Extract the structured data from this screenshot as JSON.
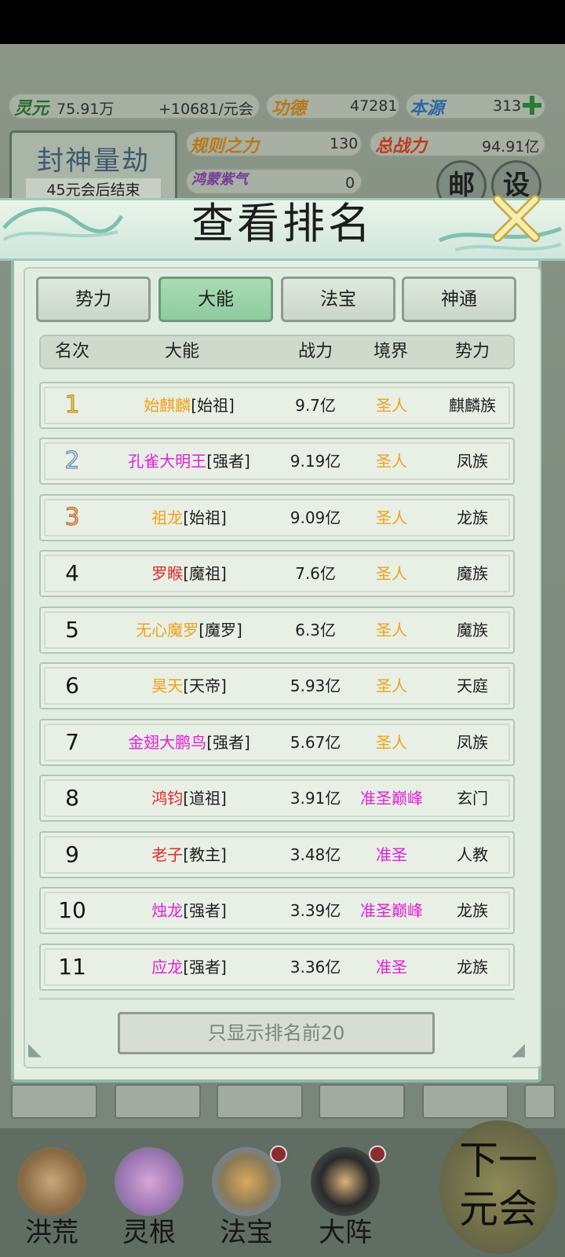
{
  "resources": {
    "lingyuan_label": "灵元",
    "lingyuan_value": "75.91万",
    "lingyuan_rate": "+10681/元会",
    "gongde_label": "功德",
    "gongde_value": "47281",
    "benyuan_label": "本源",
    "benyuan_value": "313",
    "guize_label": "规则之力",
    "guize_value": "130",
    "zongzhanli_label": "总战力",
    "zongzhanli_value": "94.91亿",
    "hongmeng_label": "鸿蒙紫气",
    "hongmeng_value": "0"
  },
  "event": {
    "title": "封神量劫",
    "subtitle": "45元会后结束"
  },
  "side_icons": {
    "mail": "邮",
    "settings": "设"
  },
  "modal": {
    "title": "查看排名",
    "tabs": [
      {
        "label": "势力",
        "active": false
      },
      {
        "label": "大能",
        "active": true
      },
      {
        "label": "法宝",
        "active": false
      },
      {
        "label": "神通",
        "active": false
      }
    ],
    "headers": [
      "名次",
      "大能",
      "战力",
      "境界",
      "势力"
    ],
    "rows": [
      {
        "rank": "1",
        "name": "始麒麟",
        "title": "[始祖]",
        "power": "9.7亿",
        "realm": "圣人",
        "faction": "麒麟族",
        "name_color": "#f0a21a",
        "realm_color": "#f0a21a"
      },
      {
        "rank": "2",
        "name": "孔雀大明王",
        "title": "[强者]",
        "power": "9.19亿",
        "realm": "圣人",
        "faction": "凤族",
        "name_color": "#e020d8",
        "realm_color": "#f0a21a"
      },
      {
        "rank": "3",
        "name": "祖龙",
        "title": "[始祖]",
        "power": "9.09亿",
        "realm": "圣人",
        "faction": "龙族",
        "name_color": "#f0a21a",
        "realm_color": "#f0a21a"
      },
      {
        "rank": "4",
        "name": "罗睺",
        "title": "[魔祖]",
        "power": "7.6亿",
        "realm": "圣人",
        "faction": "魔族",
        "name_color": "#e22828",
        "realm_color": "#f0a21a"
      },
      {
        "rank": "5",
        "name": "无心魔罗",
        "title": "[魔罗]",
        "power": "6.3亿",
        "realm": "圣人",
        "faction": "魔族",
        "name_color": "#f0a21a",
        "realm_color": "#f0a21a"
      },
      {
        "rank": "6",
        "name": "昊天",
        "title": "[天帝]",
        "power": "5.93亿",
        "realm": "圣人",
        "faction": "天庭",
        "name_color": "#f0a21a",
        "realm_color": "#f0a21a"
      },
      {
        "rank": "7",
        "name": "金翅大鹏鸟",
        "title": "[强者]",
        "power": "5.67亿",
        "realm": "圣人",
        "faction": "凤族",
        "name_color": "#e020d8",
        "realm_color": "#f0a21a"
      },
      {
        "rank": "8",
        "name": "鸿钧",
        "title": "[道祖]",
        "power": "3.91亿",
        "realm": "准圣巅峰",
        "faction": "玄门",
        "name_color": "#e22828",
        "realm_color": "#e020d8"
      },
      {
        "rank": "9",
        "name": "老子",
        "title": "[教主]",
        "power": "3.48亿",
        "realm": "准圣",
        "faction": "人教",
        "name_color": "#e22828",
        "realm_color": "#e020d8"
      },
      {
        "rank": "10",
        "name": "烛龙",
        "title": "[强者]",
        "power": "3.39亿",
        "realm": "准圣巅峰",
        "faction": "龙族",
        "name_color": "#e020d8",
        "realm_color": "#e020d8"
      },
      {
        "rank": "11",
        "name": "应龙",
        "title": "[强者]",
        "power": "3.36亿",
        "realm": "准圣",
        "faction": "龙族",
        "name_color": "#e020d8",
        "realm_color": "#e020d8"
      }
    ],
    "footer_button": "只显示排名前20"
  },
  "bottom_nav": {
    "items": [
      {
        "label": "洪荒"
      },
      {
        "label": "灵根"
      },
      {
        "label": "法宝"
      },
      {
        "label": "大阵"
      }
    ],
    "next_label_line1": "下一",
    "next_label_line2": "元会"
  }
}
